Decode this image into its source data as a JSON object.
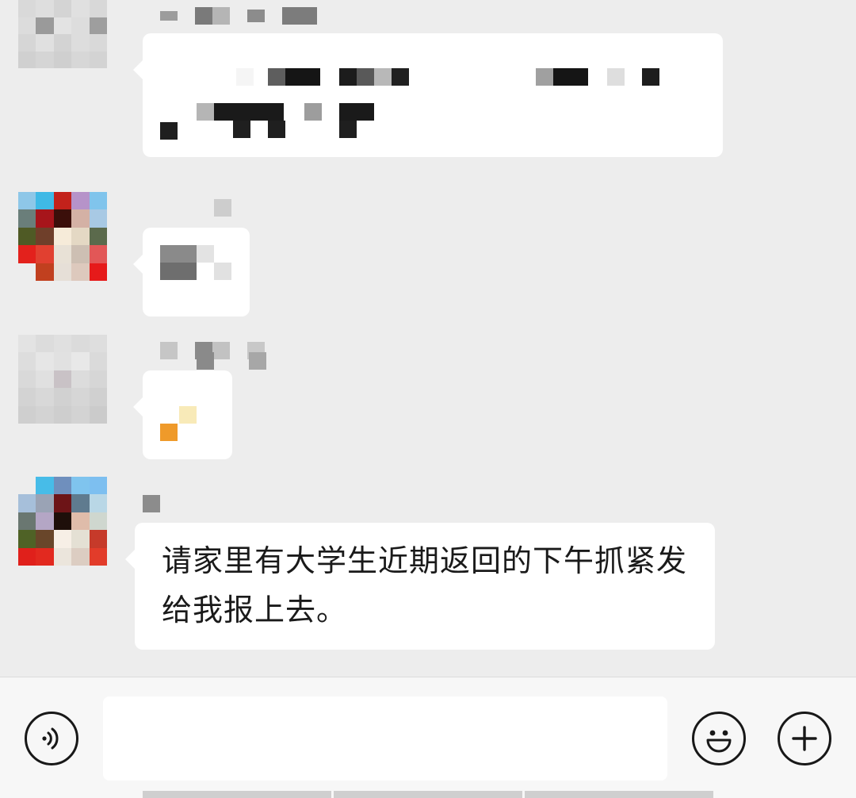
{
  "chat": {
    "messages": [
      {
        "id": "m1",
        "sender": "redacted",
        "content": "redacted",
        "redacted": true
      },
      {
        "id": "m2",
        "sender": "redacted",
        "content": "redacted",
        "redacted": true
      },
      {
        "id": "m3",
        "sender": "redacted",
        "content": "redacted",
        "redacted": true
      },
      {
        "id": "m4",
        "sender": "redacted",
        "content": "请家里有大学生近期返回的下午抓紧发给我报上去。",
        "redacted": false
      }
    ]
  },
  "input_bar": {
    "voice_icon": "voice-icon",
    "emoji_icon": "emoji-icon",
    "plus_icon": "plus-icon",
    "input_value": ""
  },
  "colors": {
    "background": "#ededed",
    "bubble": "#ffffff",
    "bottom_bar": "#f7f7f7",
    "icon_stroke": "#181818"
  }
}
